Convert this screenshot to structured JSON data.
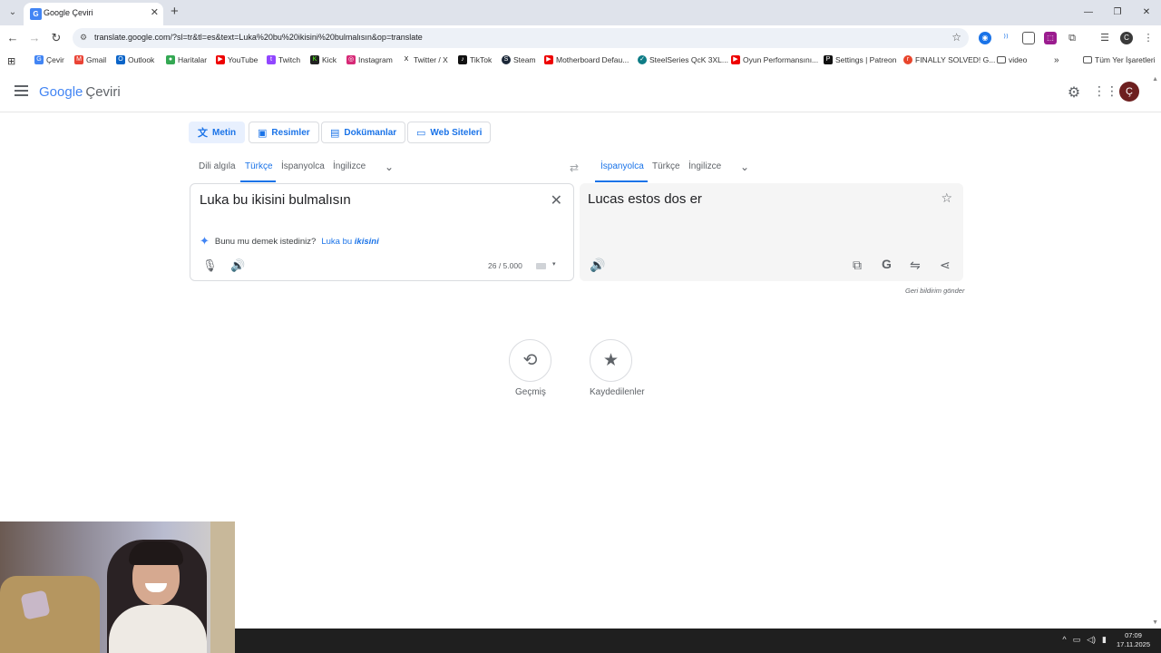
{
  "browser": {
    "tab_title": "Google Çeviri",
    "tab_favicon": "translate-favicon",
    "url": "translate.google.com/?sl=tr&tl=es&text=Luka%20bu%20ikisini%20bulmalısın&op=translate",
    "bookmarks": [
      "Çevir",
      "Gmail",
      "Outlook",
      "Haritalar",
      "YouTube",
      "Twitch",
      "Kick",
      "Instagram",
      "Twitter / X",
      "TikTok",
      "Steam",
      "Motherboard Defau...",
      "SteelSeries QcK 3XL...",
      "Oyun Performansını...",
      "Settings | Patreon",
      "FINALLY SOLVED! G...",
      "video"
    ],
    "all_bookmarks": "Tüm Yer İşaretleri"
  },
  "app": {
    "logo_google": "Google",
    "logo_product": "Çeviri",
    "avatar_letter": "Ç",
    "modes": [
      "Metin",
      "Resimler",
      "Dokümanlar",
      "Web Siteleri"
    ],
    "source_langs": [
      "Dili algıla",
      "Türkçe",
      "İspanyolca",
      "İngilizce"
    ],
    "target_langs": [
      "İspanyolca",
      "Türkçe",
      "İngilizce"
    ],
    "source_text": "Luka bu ikisini bulmalısın",
    "suggestion_prefix": "Bunu mu demek istediniz?",
    "suggestion_plain": "Luka bu",
    "suggestion_bold": "ikisini",
    "char_count": "26 / 5.000",
    "translation": "Lucas estos dos er",
    "feedback": "Geri bildirim gönder",
    "history_label": "Geçmiş",
    "saved_label": "Kaydedilenler"
  },
  "taskbar": {
    "time": "07:09",
    "date": "17.11.2025"
  },
  "colors": {
    "accent": "#1a73e8",
    "chrome_bg": "#dfe3eb",
    "target_panel_bg": "#f5f5f5"
  }
}
